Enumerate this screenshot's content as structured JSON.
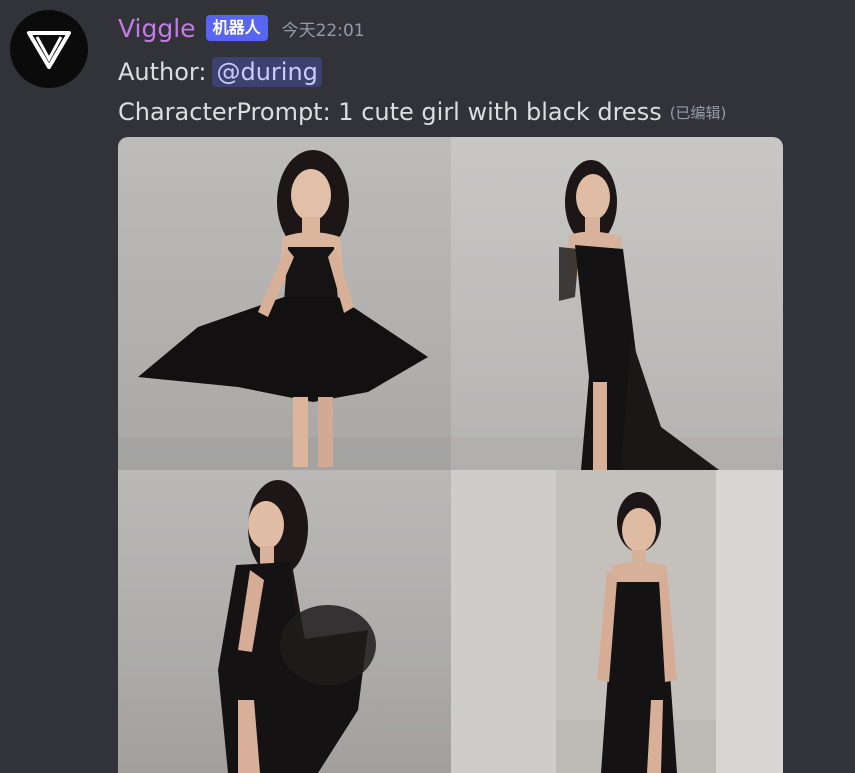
{
  "message": {
    "username": "Viggle",
    "bot_tag": "机器人",
    "timestamp": "今天22:01",
    "author_label": "Author:",
    "author_mention": "@during",
    "prompt_text": "CharacterPrompt: 1 cute girl with black dress",
    "edited_label": "(已编辑)"
  },
  "colors": {
    "background": "#313338",
    "username": "#c27ce6",
    "bot_tag": "#5865f2",
    "mention_bg": "#3c4270",
    "text": "#dbdee1",
    "muted": "#949ba4"
  },
  "images": [
    {
      "id": "image-1",
      "description_icon": "woman-black-dress-photo"
    },
    {
      "id": "image-2",
      "description_icon": "woman-black-dress-photo"
    },
    {
      "id": "image-3",
      "description_icon": "woman-black-dress-photo"
    },
    {
      "id": "image-4",
      "description_icon": "woman-black-dress-photo"
    }
  ]
}
